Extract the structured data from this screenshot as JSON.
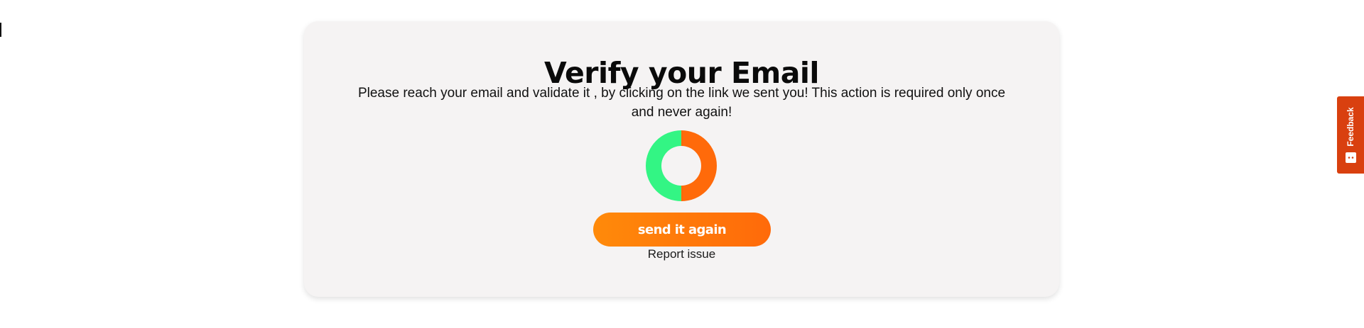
{
  "verify": {
    "title": "Verify your Email",
    "message": "Please reach your email and validate it , by clicking on the link we sent you! This action is required only once and never again!",
    "resend_label": "send it again",
    "report_label": "Report issue"
  },
  "spinner": {
    "icon": "loading-spinner-icon",
    "colors": [
      "#33f584",
      "#ff6a0a"
    ]
  },
  "feedback": {
    "label": "Feedback",
    "icon": "feedback-chat-icon",
    "color": "#d9400f"
  },
  "colors": {
    "accent": "#ff7a0a",
    "card_background": "#f5f3f3"
  }
}
